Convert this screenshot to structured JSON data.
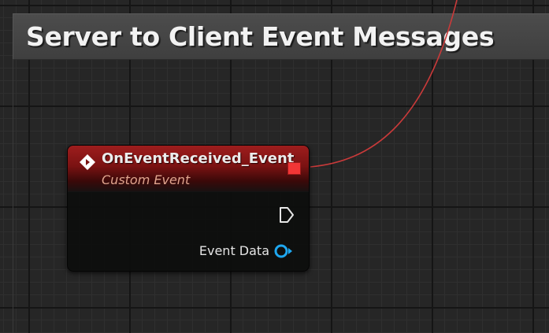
{
  "comment": {
    "title": "Server to Client Event Messages"
  },
  "node": {
    "title": "OnEventReceived_Event",
    "subtitle": "Custom Event",
    "icon": "event-diamond-icon",
    "header_color": "#9e1d1d",
    "delegate_pin_color": "#f23636",
    "output_pin_label": "Event Data",
    "output_pin_color": "#1ea7f0",
    "exec_pin_icon": "exec-arrow-icon"
  },
  "wire": {
    "color": "#c93a3a"
  }
}
